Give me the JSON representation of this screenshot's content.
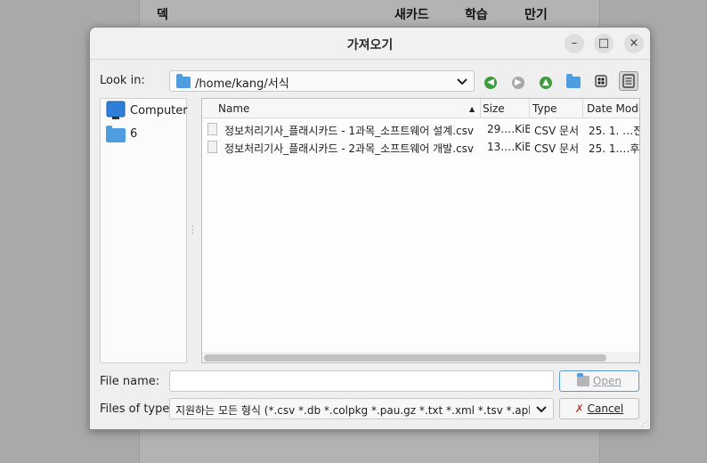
{
  "background_app": {
    "columns": [
      "덱",
      "새카드",
      "학습",
      "만기"
    ]
  },
  "dialog": {
    "title": "가져오기",
    "window_buttons": {
      "minimize": "–",
      "maximize": "□",
      "close": "×"
    },
    "look_in_label": "Look in:",
    "look_in_path": "/home/kang/서식",
    "toolbar": [
      "back-icon",
      "forward-icon",
      "parent-dir-icon",
      "new-folder-icon",
      "icon-view-icon",
      "detail-view-icon"
    ],
    "sidebar": [
      {
        "label": "Computer",
        "icon": "computer-icon"
      },
      {
        "label": "6",
        "icon": "folder-icon"
      }
    ],
    "columns": {
      "name": "Name",
      "size": "Size",
      "type": "Type",
      "date": "Date Modif"
    },
    "files": [
      {
        "name": "정보처리기사_플래시카드 - 1과목_소프트웨어 설계.csv",
        "size": "29.…KiB",
        "type": "CSV 문서",
        "date": "25. 1. …전"
      },
      {
        "name": "정보처리기사_플래시카드 - 2과목_소프트웨어 개발.csv",
        "size": "13.…KiB",
        "type": "CSV 문서",
        "date": "25. 1.…후"
      }
    ],
    "file_name_label": "File name:",
    "file_name_value": "",
    "files_of_type_label": "Files of type:",
    "files_of_type_value": "지원하는 모든 형식 (*.csv *.db *.colpkg *.pau.gz *.txt *.xml *.tsv *.apkg *.",
    "open_label": "Open",
    "cancel_label": "Cancel"
  }
}
